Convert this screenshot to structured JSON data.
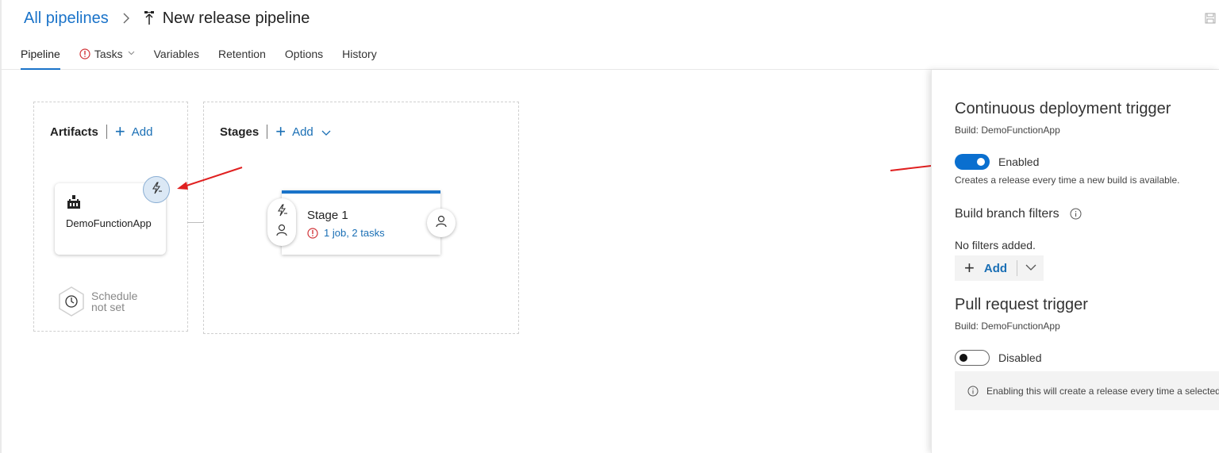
{
  "breadcrumb": {
    "root_label": "All pipelines",
    "pipeline_title": "New release pipeline"
  },
  "tabs": [
    {
      "label": "Pipeline",
      "active": true
    },
    {
      "label": "Tasks",
      "active": false,
      "warning": true
    },
    {
      "label": "Variables",
      "active": false
    },
    {
      "label": "Retention",
      "active": false
    },
    {
      "label": "Options",
      "active": false
    },
    {
      "label": "History",
      "active": false
    }
  ],
  "artifacts": {
    "title": "Artifacts",
    "add_label": "Add",
    "artifact_name": "DemoFunctionApp",
    "schedule_line1": "Schedule",
    "schedule_line2": "not set"
  },
  "stages": {
    "title": "Stages",
    "add_label": "Add",
    "stage_name": "Stage 1",
    "stage_summary": "1 job, 2 tasks"
  },
  "panel": {
    "cd_title": "Continuous deployment trigger",
    "cd_build": "Build: DemoFunctionApp",
    "cd_toggle_label": "Enabled",
    "cd_toggle_on": true,
    "cd_description": "Creates a release every time a new build is available.",
    "filters_title": "Build branch filters",
    "filters_empty": "No filters added.",
    "filters_add_label": "Add",
    "pr_title": "Pull request trigger",
    "pr_build": "Build: DemoFunctionApp",
    "pr_toggle_label": "Disabled",
    "pr_toggle_on": false,
    "pr_info": "Enabling this will create a release every time a selected a"
  },
  "colors": {
    "accent": "#1a73c9",
    "warning": "#d13438",
    "annotation_arrow": "#e02020"
  },
  "icons": [
    "chevron-right-icon",
    "pipeline-icon",
    "save-icon",
    "warning-icon",
    "plus-icon",
    "chevron-down-icon",
    "build-artifact-icon",
    "lightning-trigger-icon",
    "clock-icon",
    "person-icon",
    "info-icon"
  ]
}
